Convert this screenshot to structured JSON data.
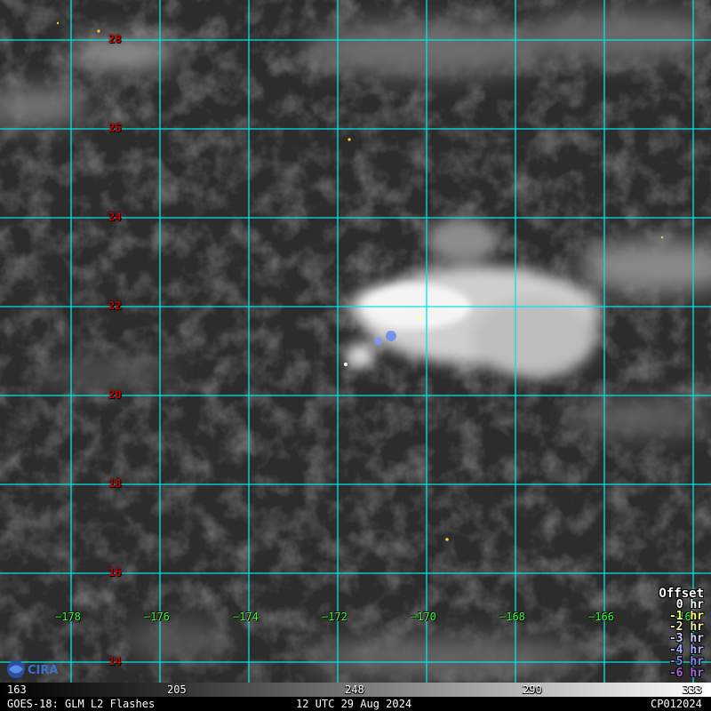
{
  "lat_labels": [
    "28",
    "26",
    "24",
    "22",
    "20",
    "18",
    "16",
    "14"
  ],
  "lon_labels": [
    "−178",
    "−176",
    "−174",
    "−172",
    "−170",
    "−168",
    "−166",
    "−164"
  ],
  "legend": {
    "title": "Offset",
    "items": [
      {
        "label": "0 hr",
        "color": "#ffffff"
      },
      {
        "label": "-1 hr",
        "color": "#ffff66"
      },
      {
        "label": "-2 hr",
        "color": "#eeeeaa"
      },
      {
        "label": "-3 hr",
        "color": "#ccccff"
      },
      {
        "label": "-4 hr",
        "color": "#aaaaff"
      },
      {
        "label": "-5 hr",
        "color": "#8888ee"
      },
      {
        "label": "-6 hr",
        "color": "#aa66dd"
      }
    ]
  },
  "colorbar": {
    "ticks": [
      "163",
      "205",
      "248",
      "290",
      "333"
    ]
  },
  "footer": {
    "product": "GOES-18: GLM L2 Flashes",
    "datetime": "12 UTC 29 Aug 2024",
    "storm_id": "CP012024"
  },
  "logo": {
    "text": "CIRA",
    "icon": "cira-logo-icon"
  },
  "colors": {
    "grid": "#00e5e5",
    "lat_label": "#cc0000",
    "lon_label": "#33ff33",
    "flash_recent": "#ffcc33",
    "flash_old": "#6688ee"
  }
}
